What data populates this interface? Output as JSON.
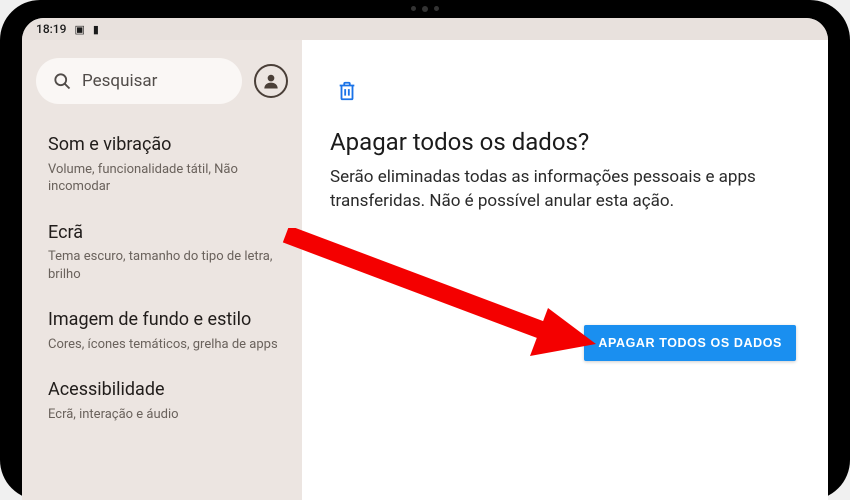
{
  "status_bar": {
    "time": "18:19"
  },
  "sidebar": {
    "search_placeholder": "Pesquisar",
    "items": [
      {
        "title": "Som e vibração",
        "subtitle": "Volume, funcionalidade tátil, Não incomodar"
      },
      {
        "title": "Ecrã",
        "subtitle": "Tema escuro, tamanho do tipo de letra, brilho"
      },
      {
        "title": "Imagem de fundo e estilo",
        "subtitle": "Cores, ícones temáticos, grelha de apps"
      },
      {
        "title": "Acessibilidade",
        "subtitle": "Ecrã, interação e áudio"
      }
    ]
  },
  "main": {
    "title": "Apagar todos os dados?",
    "description": "Serão eliminadas todas as informações pessoais e apps transferidas. Não é possível anular esta ação.",
    "action_label": "APAGAR TODOS OS DADOS"
  }
}
